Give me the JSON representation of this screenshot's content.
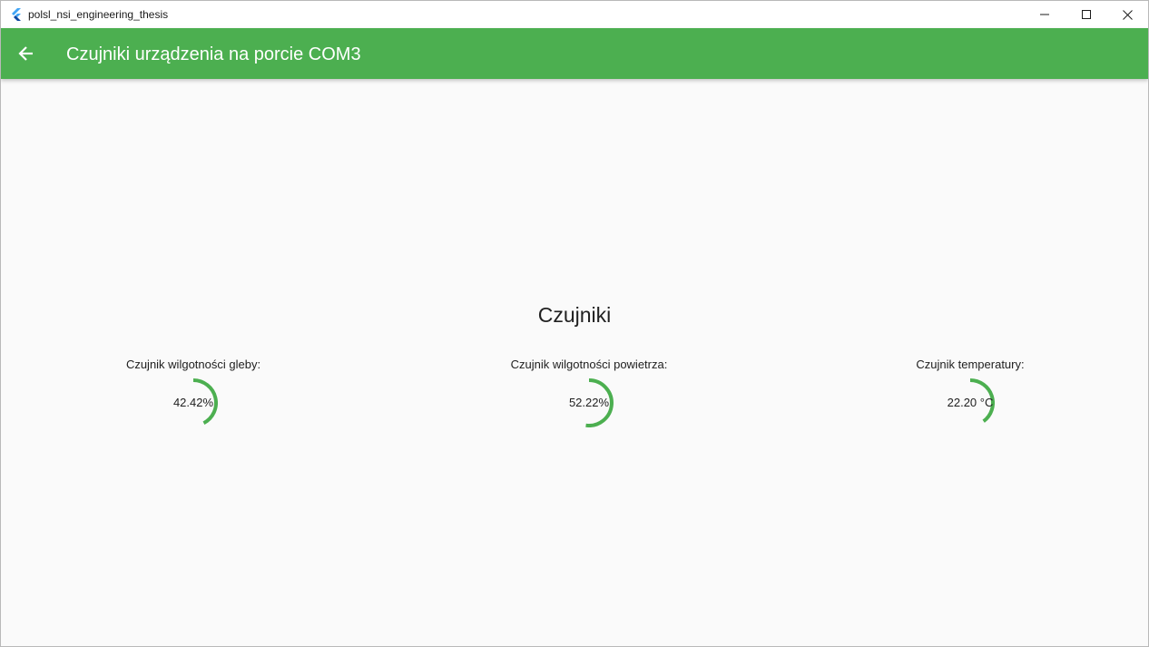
{
  "window": {
    "title": "polsl_nsi_engineering_thesis",
    "icon": "flutter-icon"
  },
  "appbar": {
    "title": "Czujniki urządzenia na porcie COM3",
    "back_icon": "arrow-back-icon",
    "color": "#4caf50"
  },
  "main": {
    "heading": "Czujniki",
    "sensors": [
      {
        "label": "Czujnik wilgotności gleby:",
        "value": "42.42%",
        "progress": 0.4242
      },
      {
        "label": "Czujnik wilgotności powietrza:",
        "value": "52.22%",
        "progress": 0.5222
      },
      {
        "label": "Czujnik temperatury:",
        "value": "22.20 °C",
        "progress": 0.4
      }
    ],
    "gauge_color": "#4caf50"
  }
}
